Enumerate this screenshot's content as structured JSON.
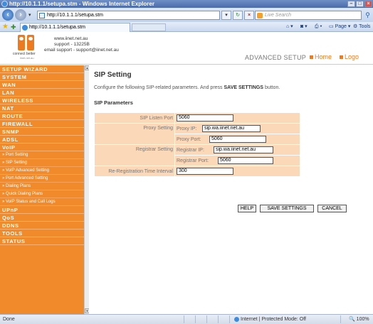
{
  "browser": {
    "title": "http://10.1.1.1/setupa.stm - Windows Internet Explorer",
    "address": "http://10.1.1.1/setupa.stm",
    "search_placeholder": "Live Search",
    "tab_title": "http://10.1.1.1/setupa.stm",
    "commands": {
      "page": "Page",
      "tools": "Tools"
    },
    "status": "Done",
    "zone": "Internet | Protected Mode: Off",
    "zoom": "100%"
  },
  "header": {
    "logo_tagline": "connect better",
    "logo_domain": "iinet.net.au",
    "website": "www.iinet.net.au",
    "support_phone": "support - 13225B",
    "support_email": "email support - support@iinet.net.au",
    "section_label": "ADVANCED SETUP",
    "home_label": "Home",
    "logout_label": "Logo"
  },
  "sidebar": {
    "items": [
      {
        "label": "SETUP WIZARD",
        "type": "category"
      },
      {
        "label": "SYSTEM",
        "type": "category"
      },
      {
        "label": "WAN",
        "type": "category"
      },
      {
        "label": "LAN",
        "type": "category"
      },
      {
        "label": "WIRELESS",
        "type": "category"
      },
      {
        "label": "NAT",
        "type": "category"
      },
      {
        "label": "ROUTE",
        "type": "category"
      },
      {
        "label": "FIREWALL",
        "type": "category"
      },
      {
        "label": "SNMP",
        "type": "category"
      },
      {
        "label": "ADSL",
        "type": "category"
      },
      {
        "label": "VoIP",
        "type": "category"
      },
      {
        "label": "» Port Setting",
        "type": "sub"
      },
      {
        "label": "» SIP Setting",
        "type": "sub"
      },
      {
        "label": "» VoIP Advanced Setting",
        "type": "sub"
      },
      {
        "label": "» Port Advanced Setting",
        "type": "sub"
      },
      {
        "label": "» Dialing Plans",
        "type": "sub"
      },
      {
        "label": "» Quick Dialing Plans",
        "type": "sub"
      },
      {
        "label": "» VoIP Status and Call Logs",
        "type": "sub"
      },
      {
        "label": "UPnP",
        "type": "category"
      },
      {
        "label": "QoS",
        "type": "category"
      },
      {
        "label": "DDNS",
        "type": "category"
      },
      {
        "label": "TOOLS",
        "type": "category"
      },
      {
        "label": "STATUS",
        "type": "category"
      }
    ]
  },
  "main": {
    "title": "SIP Setting",
    "intro_prefix": "Configure the following SIP-related parameters. And press ",
    "intro_bold": "SAVE SETTINGS",
    "intro_suffix": " button.",
    "section_title": "SIP Parameters",
    "listen_port_label": "SIP Listen Port",
    "listen_port_value": "5060",
    "proxy_label": "Proxy Setting",
    "proxy_ip_label": "Proxy IP:",
    "proxy_ip_value": "sip.wa.iinet.net.au",
    "proxy_port_label": "Proxy Port:",
    "proxy_port_value": "5060",
    "registrar_label": "Registrar Setting",
    "registrar_ip_label": "Registrar IP:",
    "registrar_ip_value": "sip.wa.iinet.net.au",
    "registrar_port_label": "Registrar Port:",
    "registrar_port_value": "5060",
    "rereg_label": "Re-Registration Time Interval",
    "rereg_value": "300",
    "help_label": "HELP",
    "save_label": "SAVE SETTINGS",
    "cancel_label": "CANCEL"
  }
}
